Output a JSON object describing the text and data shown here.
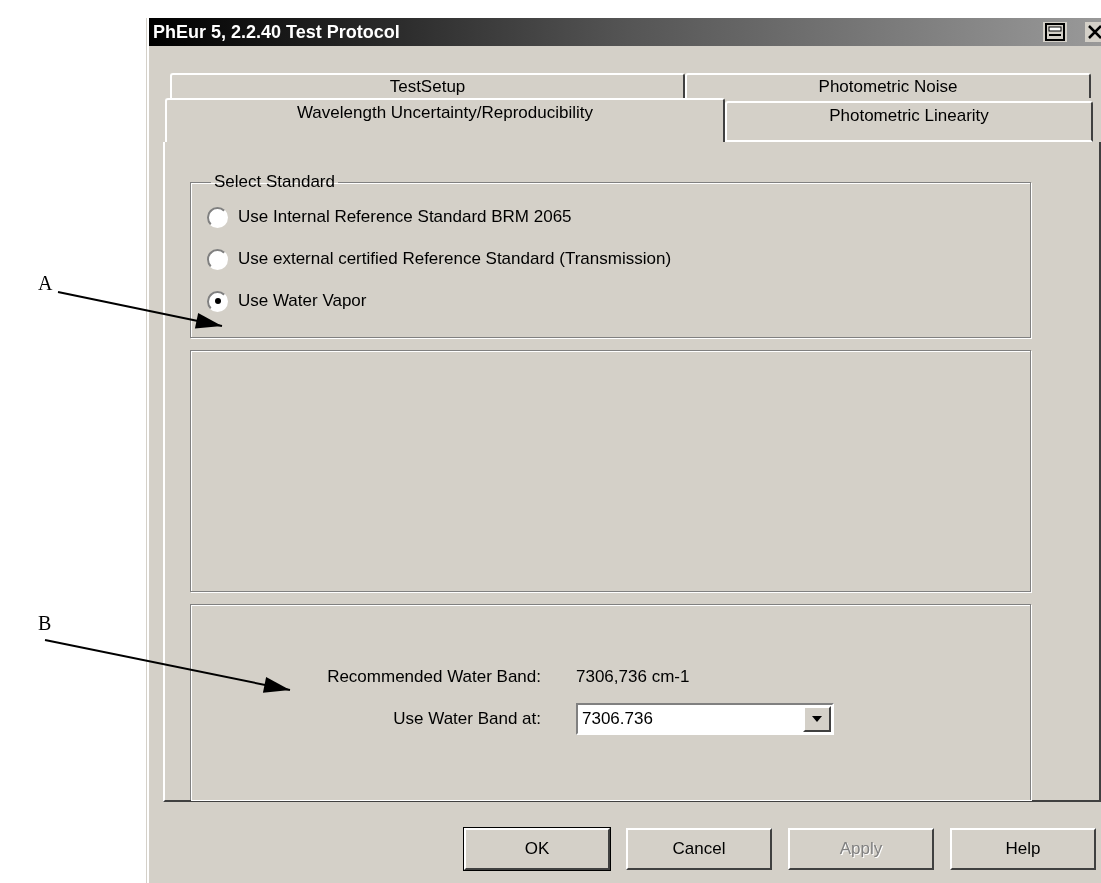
{
  "window": {
    "title": "PhEur 5, 2.2.40 Test Protocol"
  },
  "tab_rows": [
    [
      {
        "label": "TestSetup",
        "selected": false
      },
      {
        "label": "Photometric Noise",
        "selected": false
      }
    ],
    [
      {
        "label": "Wavelength Uncertainty/Reproducibility",
        "selected": true
      },
      {
        "label": "Photometric Linearity",
        "selected": false
      }
    ]
  ],
  "select_standard": {
    "title": "Select Standard",
    "options": [
      {
        "label": "Use Internal Reference Standard BRM 2065",
        "selected": false
      },
      {
        "label": "Use external certified Reference Standard (Transmission)",
        "selected": false
      },
      {
        "label": "Use Water Vapor",
        "selected": true
      }
    ]
  },
  "water_band": {
    "recommended_label": "Recommended Water Band:",
    "recommended_value": "7306,736 cm-1",
    "use_label": "Use Water Band at:",
    "use_value": "7306.736"
  },
  "buttons": [
    {
      "label": "OK",
      "disabled": false,
      "default": true
    },
    {
      "label": "Cancel",
      "disabled": false,
      "default": false
    },
    {
      "label": "Apply",
      "disabled": true,
      "default": false
    },
    {
      "label": "Help",
      "disabled": false,
      "default": false
    }
  ],
  "callouts": [
    {
      "label": "A"
    },
    {
      "label": "B"
    }
  ]
}
